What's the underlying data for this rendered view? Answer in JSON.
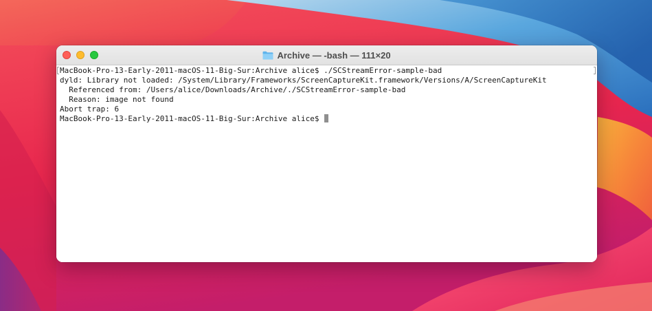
{
  "window": {
    "title": "Archive — -bash — 111×20",
    "title_icon": "folder-icon"
  },
  "terminal": {
    "lines": [
      "MacBook-Pro-13-Early-2011-macOS-11-Big-Sur:Archive alice$ ./SCStreamError-sample-bad",
      "dyld: Library not loaded: /System/Library/Frameworks/ScreenCaptureKit.framework/Versions/A/ScreenCaptureKit",
      "  Referenced from: /Users/alice/Downloads/Archive/./SCStreamError-sample-bad",
      "  Reason: image not found",
      "Abort trap: 6"
    ],
    "prompt": "MacBook-Pro-13-Early-2011-macOS-11-Big-Sur:Archive alice$ "
  },
  "colors": {
    "close": "#fe5f57",
    "minimize": "#febc2e",
    "zoom": "#28c840",
    "cursor": "#8f8f8f"
  }
}
